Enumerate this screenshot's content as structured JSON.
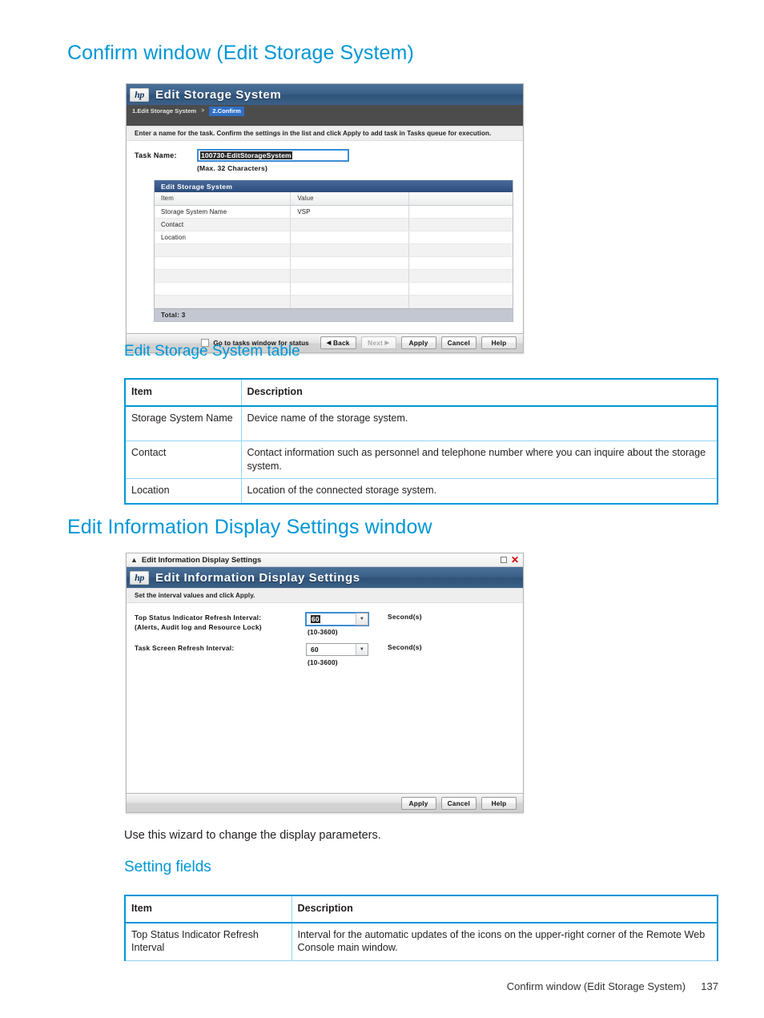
{
  "page": {
    "heading1": "Confirm window (Edit Storage System)",
    "heading2": "Edit Storage System table",
    "heading3": "Edit Information Display Settings window",
    "heading4": "Setting fields",
    "paragraph": "Use this wizard to change the display parameters.",
    "footer_title": "Confirm window (Edit Storage System)",
    "footer_page": "137",
    "accent_color": "#0096d6"
  },
  "confirm_window": {
    "hp_logo": "hp",
    "title": "Edit Storage System",
    "breadcrumb": {
      "step1": "1.Edit Storage System",
      "separator": ">",
      "step2": "2.Confirm"
    },
    "instruction": "Enter a name for the task. Confirm the settings in the list and click Apply to add task in Tasks queue for execution.",
    "task_name": {
      "label": "Task Name:",
      "value": "100730-EditStorageSystem",
      "hint": "(Max. 32 Characters)"
    },
    "grid": {
      "title": "Edit Storage System",
      "columns": [
        "Item",
        "Value",
        ""
      ],
      "rows": [
        [
          "Storage System Name",
          "VSP",
          ""
        ],
        [
          "Contact",
          "",
          ""
        ],
        [
          "Location",
          "",
          ""
        ],
        [
          "",
          "",
          ""
        ],
        [
          "",
          "",
          ""
        ],
        [
          "",
          "",
          ""
        ],
        [
          "",
          "",
          ""
        ],
        [
          "",
          "",
          ""
        ]
      ],
      "total": "Total:  3"
    },
    "footer": {
      "checkbox_label": "Go to tasks window for status",
      "back": "Back",
      "next": "Next",
      "apply": "Apply",
      "cancel": "Cancel",
      "help": "Help"
    }
  },
  "edit_storage_table": {
    "columns": [
      "Item",
      "Description"
    ],
    "rows": [
      [
        "Storage System Name",
        "Device name of the storage system."
      ],
      [
        "Contact",
        "Contact information such as personnel and telephone number where you can inquire about the storage system."
      ],
      [
        "Location",
        "Location of the connected storage system."
      ]
    ]
  },
  "display_settings_window": {
    "os_title": "Edit Information Display Settings",
    "hp_logo": "hp",
    "title": "Edit Information Display Settings",
    "instruction": "Set the interval values and click Apply.",
    "fields": [
      {
        "label_line1": "Top Status Indicator Refresh Interval:",
        "label_line2": "(Alerts, Audit log and Resource Lock)",
        "value": "60",
        "unit": "Second(s)",
        "range": "(10-3600)",
        "focused": true
      },
      {
        "label_line1": "Task Screen Refresh Interval:",
        "label_line2": "",
        "value": "60",
        "unit": "Second(s)",
        "range": "(10-3600)",
        "focused": false
      }
    ],
    "footer": {
      "apply": "Apply",
      "cancel": "Cancel",
      "help": "Help"
    }
  },
  "setting_fields_table": {
    "columns": [
      "Item",
      "Description"
    ],
    "rows": [
      [
        "Top Status Indicator Refresh Interval",
        "Interval for the automatic updates of the icons on the upper-right corner of the Remote Web Console main window."
      ]
    ]
  }
}
